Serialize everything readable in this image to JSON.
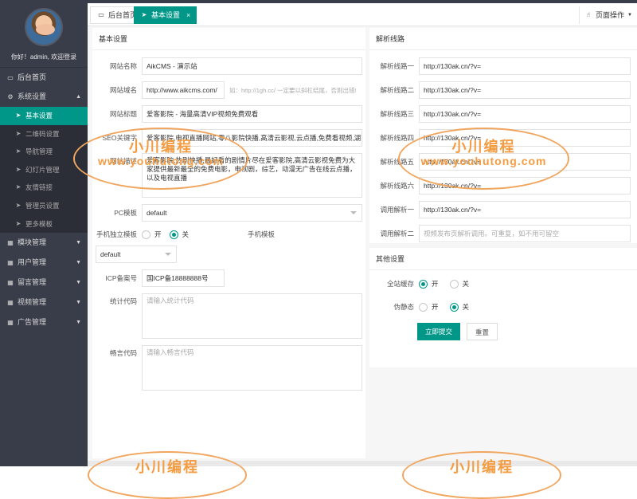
{
  "sidebar": {
    "greeting": "你好！admin, 欢迎登录",
    "home": "后台首页",
    "system": "系统设置",
    "system_items": [
      "基本设置",
      "二维码设置",
      "导航管理",
      "幻灯片管理",
      "友情链接",
      "管理员设置",
      "更多模板"
    ],
    "modules": [
      "模块管理",
      "用户管理",
      "留言管理",
      "视频管理",
      "广告管理"
    ]
  },
  "tabs": {
    "home": "后台首页",
    "active": "基本设置",
    "close": "×",
    "page_ops": "页面操作"
  },
  "basic": {
    "title": "基本设置",
    "site_name_label": "网站名称",
    "site_name": "AikCMS - 演示站",
    "domain_label": "网站域名",
    "domain": "http://www.aikcms.com/",
    "domain_hint": "如：http://1gh.cc/ 一定要以斜杠结尾，否则出错!",
    "site_title_label": "网站标题",
    "site_title": "爱客影院 - 海量高清VIP视频免费观看",
    "seo_label": "SEO关键字",
    "seo": "爱客影院,电视直播网站,零八影院快播,高清云影视,云点播,免费看视频,湖南卫视",
    "desc_label": "网站描述",
    "desc": "爱客影院,热剧快播,最好看的剧情片尽在爱客影院,高清云影视免费为大家提供最新最全的免费电影，电视剧，综艺，动漫无广告在线云点播，以及电视直播",
    "pc_tpl_label": "PC模板",
    "pc_tpl": "default",
    "mobile_label": "手机独立模板",
    "on": "开",
    "off": "关",
    "mobile_tpl_label": "手机模板",
    "mobile_tpl": "default",
    "icp_label": "ICP备案号",
    "icp": "国ICP备18888888号",
    "stat_label": "统计代码",
    "stat_placeholder": "请输入统计代码",
    "ad_label": "畅言代码",
    "ad_placeholder": "请输入畅言代码"
  },
  "parse": {
    "title": "解析线路",
    "lines": [
      {
        "label": "解析线路一",
        "value": "http://130ak.cn/?v="
      },
      {
        "label": "解析线路二",
        "value": "http://130ak.cn/?v="
      },
      {
        "label": "解析线路三",
        "value": "http://130ak.cn/?v="
      },
      {
        "label": "解析线路四",
        "value": "http://130ak.cn/?v="
      },
      {
        "label": "解析线路五",
        "value": "http://130ak.cn/?v="
      },
      {
        "label": "解析线路六",
        "value": "http://130ak.cn/?v="
      },
      {
        "label": "调用解析一",
        "value": "http://130ak.cn/?v="
      }
    ],
    "call2_label": "调用解析二",
    "call2_placeholder": "视频发布页解析调用。可重复，如不用可留空"
  },
  "other": {
    "title": "其他设置",
    "cache_label": "全站缓存",
    "pseudo_label": "伪静态",
    "on": "开",
    "off": "关",
    "submit": "立即提交",
    "reset": "重置"
  },
  "watermark": {
    "cn": "小川编程",
    "en": "www.youhutong.com"
  },
  "colors": {
    "accent": "#009688",
    "sidebar": "#393d49",
    "watermark": "#f39c42"
  }
}
